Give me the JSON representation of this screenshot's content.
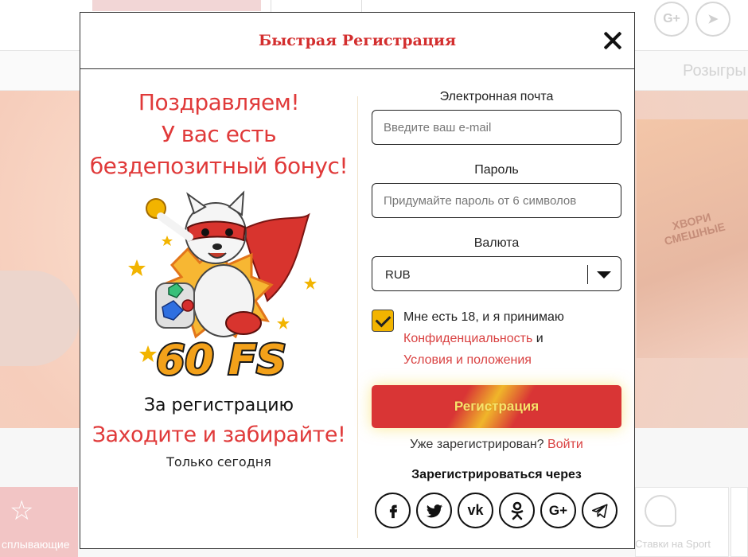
{
  "background": {
    "nav_item": "Розыгры",
    "tile_left_label": "сплывающие",
    "tile_right_label": "Ставки на Sport",
    "banner_sign": "ХВОРИ СМЕШНЫЕ"
  },
  "modal": {
    "title": "Быстрая Регистрация",
    "close_icon": "close-icon"
  },
  "promo": {
    "line1": "Поздравляем!",
    "line2": "У вас есть",
    "line3": "бездепозитный бонус!",
    "badge": "60 FS",
    "subtitle": "За регистрацию",
    "cta": "Заходите и забирайте!",
    "note": "Только сегодня",
    "colors": {
      "accent": "#e03a3a",
      "badge": "#f3a11a"
    }
  },
  "form": {
    "email": {
      "label": "Электронная почта",
      "placeholder": "Введите ваш e-mail",
      "value": ""
    },
    "password": {
      "label": "Пароль",
      "placeholder": "Придумайте пароль от 6 символов",
      "value": ""
    },
    "currency": {
      "label": "Валюта",
      "value": "RUB"
    },
    "agree": {
      "checked": true,
      "text": "Мне есть 18, и я принимаю",
      "privacy_link": "Конфиденциальность",
      "and": "и",
      "terms_link": "Условия и положения"
    },
    "submit_label": "Регистрация",
    "login_prompt": "Уже зарегистрирован?",
    "login_link": "Войти",
    "via_label": "Зарегистрироваться через",
    "social": [
      "facebook-icon",
      "twitter-icon",
      "vk-icon",
      "odnoklassniki-icon",
      "google-plus-icon",
      "telegram-icon"
    ],
    "social_texts": {
      "vk": "vk",
      "gplus": "G+"
    }
  },
  "colors": {
    "brand_red": "#d32e2e",
    "link_red": "#d94141",
    "checkbox_yellow": "#f2b400",
    "button_text": "#f7e36a"
  }
}
